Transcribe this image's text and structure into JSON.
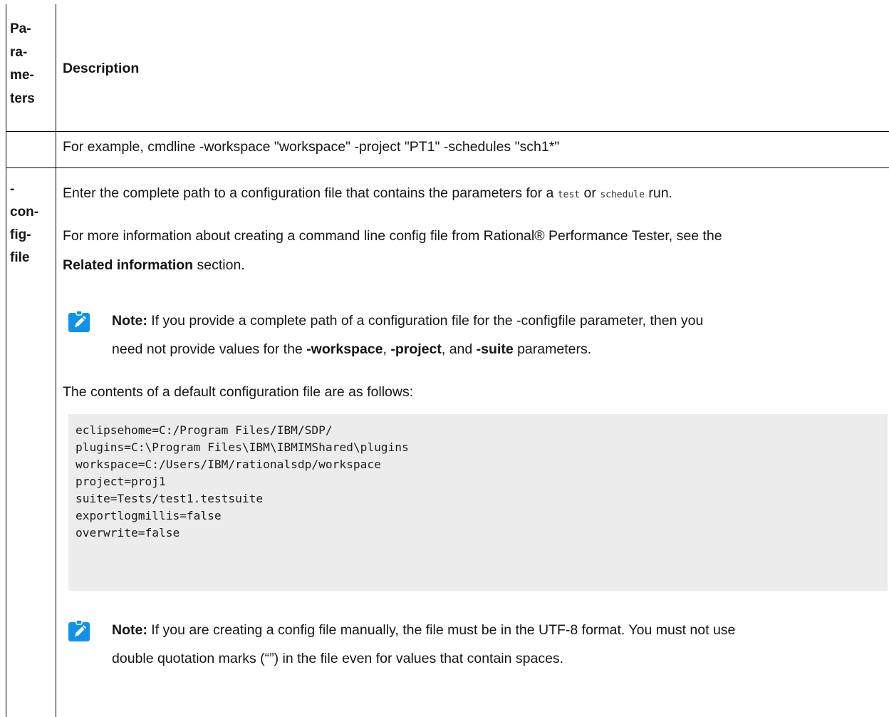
{
  "header": {
    "param_col_lines": [
      "Pa-",
      "ra-",
      "me-",
      "ters"
    ],
    "desc_col": "Description"
  },
  "row1": {
    "text": "For example, cmdline -workspace \"workspace\" -project \"PT1\" -schedules \"sch1*\""
  },
  "row2": {
    "param_lines": [
      "-",
      "con-",
      "fig-",
      "file"
    ],
    "p1_before": "Enter the complete path to a configuration file that contains the parameters for a ",
    "p1_code1": "test",
    "p1_mid": " or ",
    "p1_code2": "schedule",
    "p1_after": " run.",
    "p2_line1": "For more information about creating a command line config file from  Rational® Performance Tester, see the",
    "p2_bold": "Related information",
    "p2_after": " section.",
    "note1": {
      "label": "Note:",
      "line1": " If you provide a complete path of a configuration file for the -configfile parameter, then you",
      "l2_before": "need not provide values for the ",
      "b1": "-workspace",
      "sep1": ", ",
      "b2": "-project",
      "sep2": ", and ",
      "b3": "-suite",
      "l2_after": " parameters."
    },
    "p3": "The contents of a default configuration file are as follows:",
    "code": "eclipsehome=C:/Program Files/IBM/SDP/\nplugins=C:\\Program Files\\IBM\\IBMIMShared\\plugins\nworkspace=C:/Users/IBM/rationalsdp/workspace\nproject=proj1\nsuite=Tests/test1.testsuite\nexportlogmillis=false\noverwrite=false",
    "note2": {
      "label": "Note:",
      "line1": " If you are creating a config file manually, the file must be in the UTF-8 format. You must not use",
      "line2": "double quotation marks (“”) in the file even for values that contain spaces."
    }
  },
  "colors": {
    "note_icon_bg": "#1192e8",
    "code_bg": "#ececec"
  }
}
